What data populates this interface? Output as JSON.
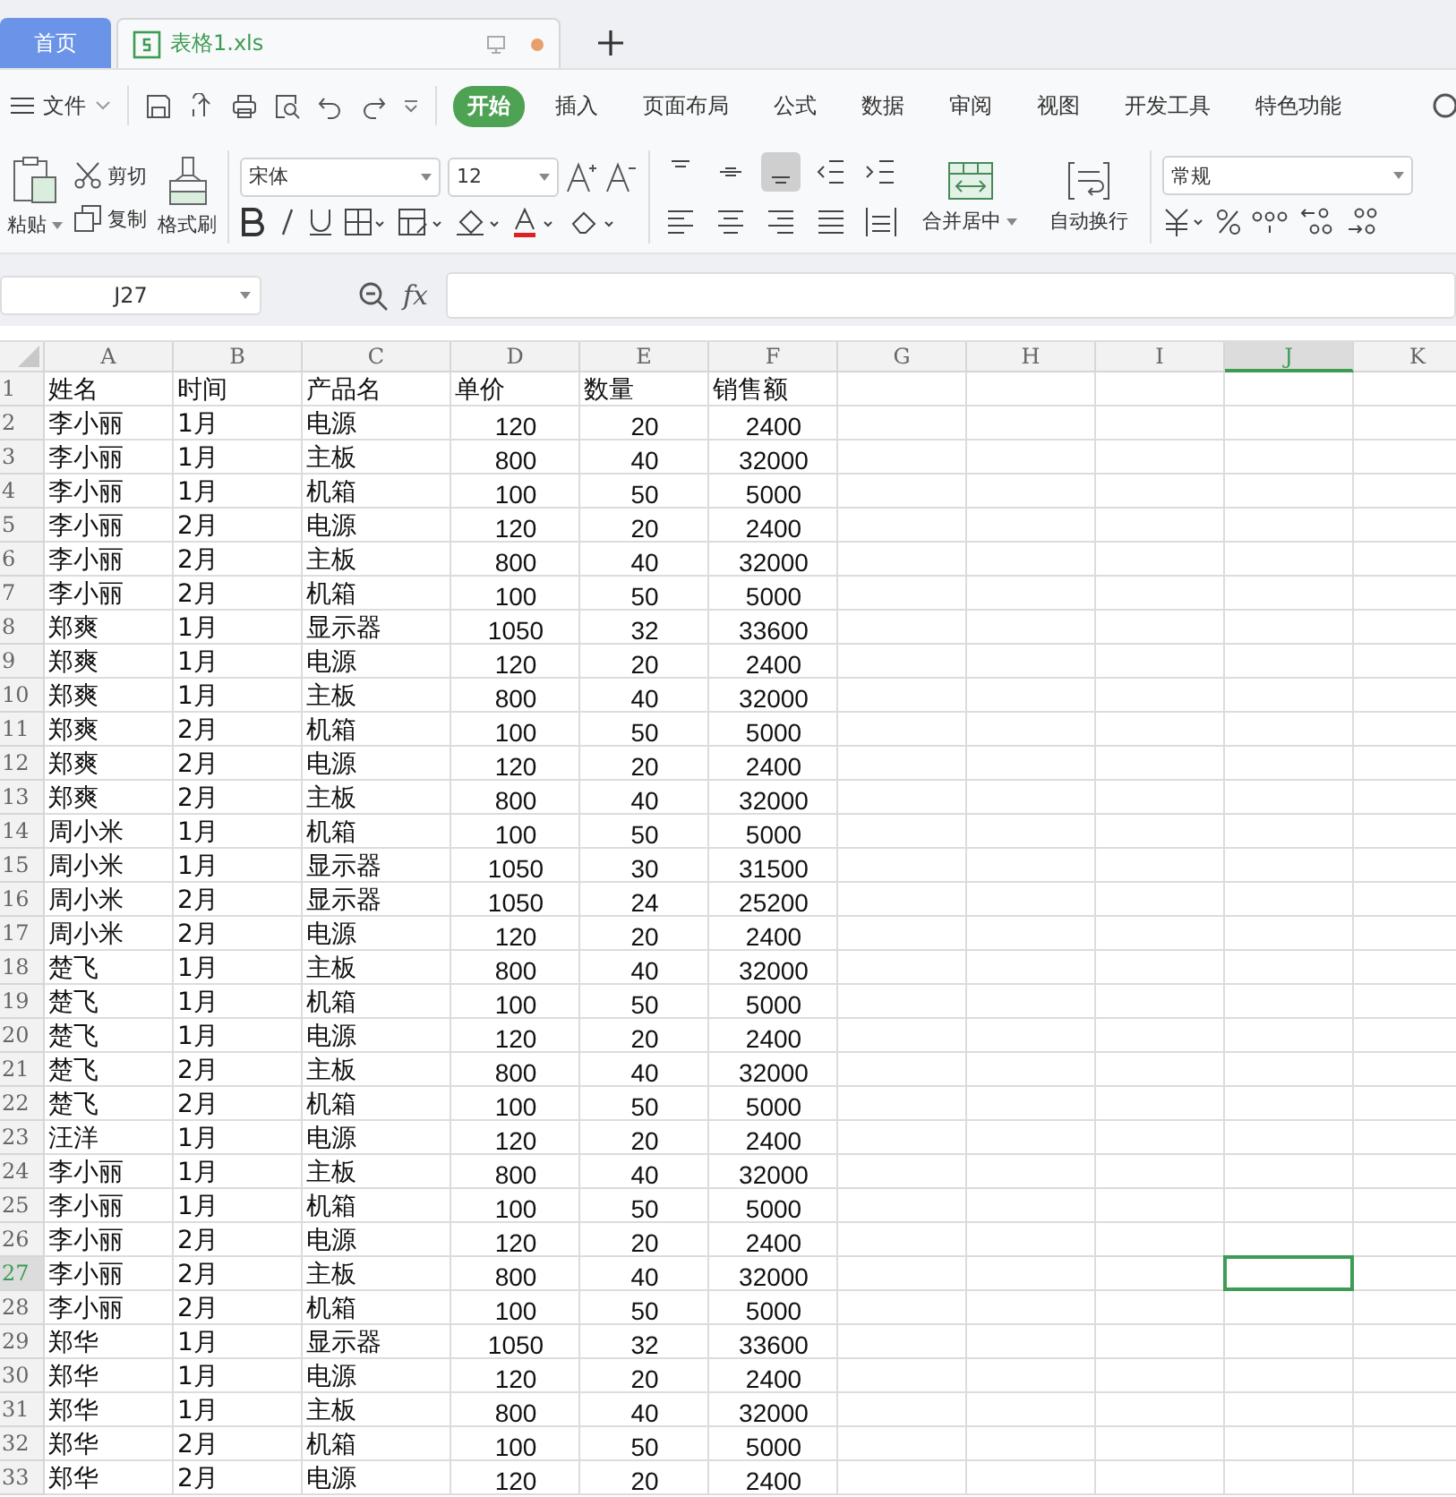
{
  "doc_tabs": [
    {
      "label": "首页",
      "kind": "home",
      "selected": false
    },
    {
      "label": "表格1.xls",
      "kind": "file",
      "selected": true
    }
  ],
  "menu": {
    "file": "文件",
    "tabs": [
      {
        "label": "开始",
        "selected": true
      },
      {
        "label": "插入",
        "selected": false
      },
      {
        "label": "页面布局",
        "selected": false
      },
      {
        "label": "公式",
        "selected": false
      },
      {
        "label": "数据",
        "selected": false
      },
      {
        "label": "审阅",
        "selected": false
      },
      {
        "label": "视图",
        "selected": false
      },
      {
        "label": "开发工具",
        "selected": false
      },
      {
        "label": "特色功能",
        "selected": false
      }
    ]
  },
  "ribbon": {
    "paste": "粘贴",
    "cut": "剪切",
    "copy": "复制",
    "format_painter": "格式刷",
    "font": "宋体",
    "font_size": "12",
    "vertical_align": [
      {
        "selected": false
      },
      {
        "selected": false
      },
      {
        "selected": true
      }
    ],
    "merge": "合并居中",
    "wrap": "自动换行",
    "number_format": "常规"
  },
  "formula_bar": {
    "name_box": "J27",
    "fx": "fx"
  },
  "sheet": {
    "columns": [
      {
        "label": "A",
        "selected": false
      },
      {
        "label": "B",
        "selected": false
      },
      {
        "label": "C",
        "selected": false
      },
      {
        "label": "D",
        "selected": false
      },
      {
        "label": "E",
        "selected": false
      },
      {
        "label": "F",
        "selected": false
      },
      {
        "label": "G",
        "selected": false
      },
      {
        "label": "H",
        "selected": false
      },
      {
        "label": "I",
        "selected": false
      },
      {
        "label": "J",
        "selected": true
      },
      {
        "label": "K",
        "selected": false
      }
    ],
    "rows": [
      {
        "number": "1",
        "kind": "header",
        "selected": false,
        "cells": [
          "姓名",
          "时间",
          "产品名",
          "单价",
          "数量",
          "销售额"
        ]
      },
      {
        "number": "2",
        "kind": "data",
        "selected": false,
        "cells": [
          "李小丽",
          "1月",
          "电源",
          "120",
          "20",
          "2400"
        ]
      },
      {
        "number": "3",
        "kind": "data",
        "selected": false,
        "cells": [
          "李小丽",
          "1月",
          "主板",
          "800",
          "40",
          "32000"
        ]
      },
      {
        "number": "4",
        "kind": "data",
        "selected": false,
        "cells": [
          "李小丽",
          "1月",
          "机箱",
          "100",
          "50",
          "5000"
        ]
      },
      {
        "number": "5",
        "kind": "data",
        "selected": false,
        "cells": [
          "李小丽",
          "2月",
          "电源",
          "120",
          "20",
          "2400"
        ]
      },
      {
        "number": "6",
        "kind": "data",
        "selected": false,
        "cells": [
          "李小丽",
          "2月",
          "主板",
          "800",
          "40",
          "32000"
        ]
      },
      {
        "number": "7",
        "kind": "data",
        "selected": false,
        "cells": [
          "李小丽",
          "2月",
          "机箱",
          "100",
          "50",
          "5000"
        ]
      },
      {
        "number": "8",
        "kind": "data",
        "selected": false,
        "cells": [
          "郑爽",
          "1月",
          "显示器",
          "1050",
          "32",
          "33600"
        ]
      },
      {
        "number": "9",
        "kind": "data",
        "selected": false,
        "cells": [
          "郑爽",
          "1月",
          "电源",
          "120",
          "20",
          "2400"
        ]
      },
      {
        "number": "10",
        "kind": "data",
        "selected": false,
        "cells": [
          "郑爽",
          "1月",
          "主板",
          "800",
          "40",
          "32000"
        ]
      },
      {
        "number": "11",
        "kind": "data",
        "selected": false,
        "cells": [
          "郑爽",
          "2月",
          "机箱",
          "100",
          "50",
          "5000"
        ]
      },
      {
        "number": "12",
        "kind": "data",
        "selected": false,
        "cells": [
          "郑爽",
          "2月",
          "电源",
          "120",
          "20",
          "2400"
        ]
      },
      {
        "number": "13",
        "kind": "data",
        "selected": false,
        "cells": [
          "郑爽",
          "2月",
          "主板",
          "800",
          "40",
          "32000"
        ]
      },
      {
        "number": "14",
        "kind": "data",
        "selected": false,
        "cells": [
          "周小米",
          "1月",
          "机箱",
          "100",
          "50",
          "5000"
        ]
      },
      {
        "number": "15",
        "kind": "data",
        "selected": false,
        "cells": [
          "周小米",
          "1月",
          "显示器",
          "1050",
          "30",
          "31500"
        ]
      },
      {
        "number": "16",
        "kind": "data",
        "selected": false,
        "cells": [
          "周小米",
          "2月",
          "显示器",
          "1050",
          "24",
          "25200"
        ]
      },
      {
        "number": "17",
        "kind": "data",
        "selected": false,
        "cells": [
          "周小米",
          "2月",
          "电源",
          "120",
          "20",
          "2400"
        ]
      },
      {
        "number": "18",
        "kind": "data",
        "selected": false,
        "cells": [
          "楚飞",
          "1月",
          "主板",
          "800",
          "40",
          "32000"
        ]
      },
      {
        "number": "19",
        "kind": "data",
        "selected": false,
        "cells": [
          "楚飞",
          "1月",
          "机箱",
          "100",
          "50",
          "5000"
        ]
      },
      {
        "number": "20",
        "kind": "data",
        "selected": false,
        "cells": [
          "楚飞",
          "1月",
          "电源",
          "120",
          "20",
          "2400"
        ]
      },
      {
        "number": "21",
        "kind": "data",
        "selected": false,
        "cells": [
          "楚飞",
          "2月",
          "主板",
          "800",
          "40",
          "32000"
        ]
      },
      {
        "number": "22",
        "kind": "data",
        "selected": false,
        "cells": [
          "楚飞",
          "2月",
          "机箱",
          "100",
          "50",
          "5000"
        ]
      },
      {
        "number": "23",
        "kind": "data",
        "selected": false,
        "cells": [
          "汪洋",
          "1月",
          "电源",
          "120",
          "20",
          "2400"
        ]
      },
      {
        "number": "24",
        "kind": "data",
        "selected": false,
        "cells": [
          "李小丽",
          "1月",
          "主板",
          "800",
          "40",
          "32000"
        ]
      },
      {
        "number": "25",
        "kind": "data",
        "selected": false,
        "cells": [
          "李小丽",
          "1月",
          "机箱",
          "100",
          "50",
          "5000"
        ]
      },
      {
        "number": "26",
        "kind": "data",
        "selected": false,
        "cells": [
          "李小丽",
          "2月",
          "电源",
          "120",
          "20",
          "2400"
        ]
      },
      {
        "number": "27",
        "kind": "data",
        "selected": true,
        "cells": [
          "李小丽",
          "2月",
          "主板",
          "800",
          "40",
          "32000"
        ]
      },
      {
        "number": "28",
        "kind": "data",
        "selected": false,
        "cells": [
          "李小丽",
          "2月",
          "机箱",
          "100",
          "50",
          "5000"
        ]
      },
      {
        "number": "29",
        "kind": "data",
        "selected": false,
        "cells": [
          "郑华",
          "1月",
          "显示器",
          "1050",
          "32",
          "33600"
        ]
      },
      {
        "number": "30",
        "kind": "data",
        "selected": false,
        "cells": [
          "郑华",
          "1月",
          "电源",
          "120",
          "20",
          "2400"
        ]
      },
      {
        "number": "31",
        "kind": "data",
        "selected": false,
        "cells": [
          "郑华",
          "1月",
          "主板",
          "800",
          "40",
          "32000"
        ]
      },
      {
        "number": "32",
        "kind": "data",
        "selected": false,
        "cells": [
          "郑华",
          "2月",
          "机箱",
          "100",
          "50",
          "5000"
        ]
      },
      {
        "number": "33",
        "kind": "data",
        "selected": false,
        "cells": [
          "郑华",
          "2月",
          "电源",
          "120",
          "20",
          "2400"
        ]
      }
    ]
  }
}
